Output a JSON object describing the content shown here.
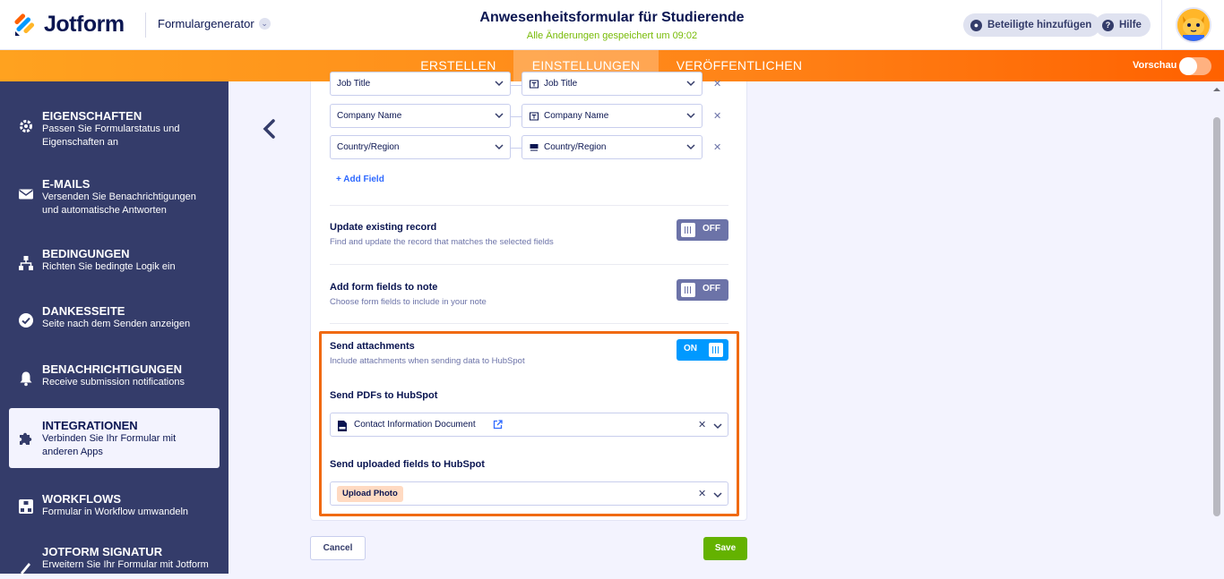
{
  "brand": {
    "logo_text": "Jotform",
    "accent": "#ff6100",
    "navy": "#0a1551"
  },
  "header": {
    "formgen_label": "Formulargenerator",
    "form_title": "Anwesenheitsformular für Studierende",
    "saved_status": "Alle Änderungen gespeichert um 09:02",
    "add_participants": "Beteiligte hinzufügen",
    "help": "Hilfe"
  },
  "nav": {
    "tabs": [
      "ERSTELLEN",
      "EINSTELLUNGEN",
      "VERÖFFENTLICHEN"
    ],
    "active_tab": "EINSTELLUNGEN",
    "preview_label": "Vorschau",
    "preview_on": false
  },
  "sidebar": {
    "items": [
      {
        "title": "EIGENSCHAFTEN",
        "desc": "Passen Sie Formularstatus und Eigenschaften an",
        "icon": "gear-icon"
      },
      {
        "title": "E-MAILS",
        "desc": "Versenden Sie Benachrichtigungen und automatische Antworten",
        "icon": "envelope-icon"
      },
      {
        "title": "BEDINGUNGEN",
        "desc": "Richten Sie bedingte Logik ein",
        "icon": "sitemap-icon"
      },
      {
        "title": "DANKESSEITE",
        "desc": "Seite nach dem Senden anzeigen",
        "icon": "check-circle-icon"
      },
      {
        "title": "BENACHRICHTIGUNGEN",
        "desc": "Receive submission notifications",
        "icon": "bell-icon"
      },
      {
        "title": "INTEGRATIONEN",
        "desc": "Verbinden Sie Ihr Formular mit anderen Apps",
        "icon": "puzzle-icon",
        "active": true
      },
      {
        "title": "WORKFLOWS",
        "desc": "Formular in Workflow umwandeln",
        "icon": "workflow-icon"
      },
      {
        "title": "JOTFORM SIGNATUR",
        "desc": "Erweitern Sie Ihr Formular mit Jotform",
        "icon": "signature-icon"
      }
    ]
  },
  "mapping": {
    "rows": [
      {
        "left": "Job Title",
        "right": "Job Title"
      },
      {
        "left": "Company Name",
        "right": "Company Name"
      },
      {
        "left": "Country/Region",
        "right": "Country/Region"
      }
    ],
    "add_field": "+ Add Field"
  },
  "options": {
    "update_existing": {
      "title": "Update existing record",
      "desc": "Find and update the record that matches the selected fields",
      "state": "OFF"
    },
    "add_to_note": {
      "title": "Add form fields to note",
      "desc": "Choose form fields to include in your note",
      "state": "OFF"
    },
    "send_attachments": {
      "title": "Send attachments",
      "desc": "Include attachments when sending data to HubSpot",
      "state": "ON"
    }
  },
  "attachments": {
    "pdf_heading": "Send PDFs to HubSpot",
    "pdf_value": "Contact Information Document",
    "uploads_heading": "Send uploaded fields to HubSpot",
    "upload_tag": "Upload Photo"
  },
  "footer": {
    "cancel": "Cancel",
    "save": "Save"
  }
}
